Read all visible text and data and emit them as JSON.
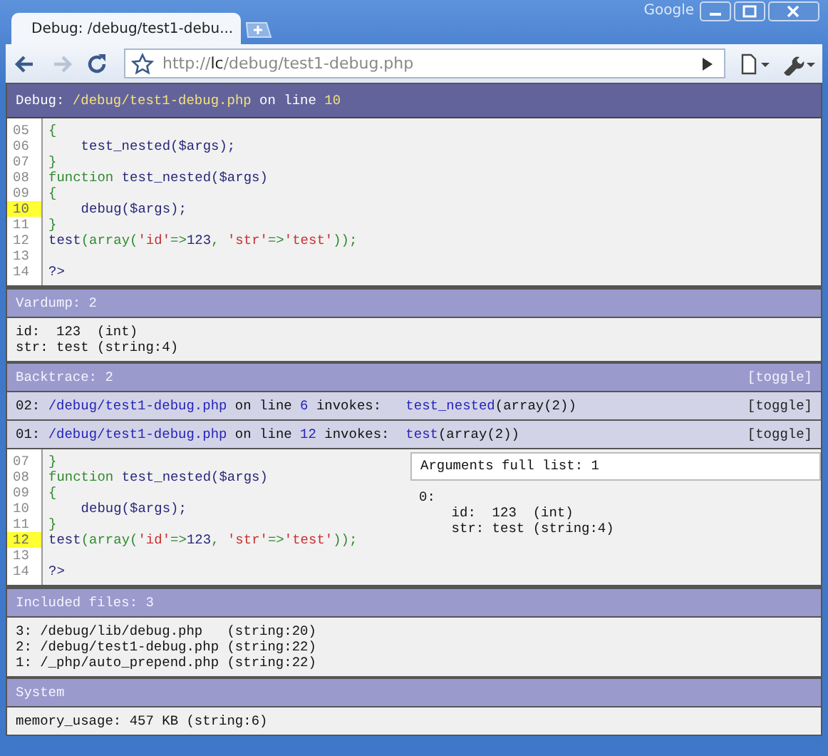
{
  "browser": {
    "tab_title": "Debug: /debug/test1-debu...",
    "brand": "Google",
    "address": "http://**lc**/debug/test1-debug.php",
    "forward_disabled": true
  },
  "debug_header": [
    {
      "text": "Debug: ",
      "kind": "plain"
    },
    {
      "text": "/debug/test1-debug.php",
      "kind": "accent"
    },
    {
      "text": " on line ",
      "kind": "plain"
    },
    {
      "text": "10",
      "kind": "accent"
    }
  ],
  "source": [
    {
      "number": "05",
      "highlighted": false,
      "tokens": [
        {
          "text": "{",
          "kind": "keyword"
        }
      ]
    },
    {
      "number": "06",
      "highlighted": false,
      "tokens": [
        {
          "text": "    test_nested($args);",
          "kind": "name"
        }
      ]
    },
    {
      "number": "07",
      "highlighted": false,
      "tokens": [
        {
          "text": "}",
          "kind": "keyword"
        }
      ]
    },
    {
      "number": "08",
      "highlighted": false,
      "tokens": [
        {
          "text": "function ",
          "kind": "keyword"
        },
        {
          "text": "test_nested($args)",
          "kind": "name"
        }
      ]
    },
    {
      "number": "09",
      "highlighted": false,
      "tokens": [
        {
          "text": "{",
          "kind": "keyword"
        }
      ]
    },
    {
      "number": "10",
      "highlighted": true,
      "tokens": [
        {
          "text": "    debug($args);",
          "kind": "name"
        }
      ]
    },
    {
      "number": "11",
      "highlighted": false,
      "tokens": [
        {
          "text": "}",
          "kind": "keyword"
        }
      ]
    },
    {
      "number": "12",
      "highlighted": false,
      "tokens": [
        {
          "text": "test",
          "kind": "name"
        },
        {
          "text": "(array(",
          "kind": "keyword"
        },
        {
          "text": "'id'",
          "kind": "string"
        },
        {
          "text": "=>",
          "kind": "keyword"
        },
        {
          "text": "123",
          "kind": "name"
        },
        {
          "text": ", ",
          "kind": "keyword"
        },
        {
          "text": "'str'",
          "kind": "string"
        },
        {
          "text": "=>",
          "kind": "keyword"
        },
        {
          "text": "'test'",
          "kind": "string"
        },
        {
          "text": "));",
          "kind": "keyword"
        }
      ]
    },
    {
      "number": "13",
      "highlighted": false
    },
    {
      "number": "14",
      "highlighted": false,
      "tokens": [
        {
          "text": "?>",
          "kind": "name"
        }
      ]
    }
  ],
  "sections": [
    {
      "kind": "text",
      "title": "Vardump: 2",
      "lines": [
        "id:  123  (int)",
        "str: test (string:4)"
      ]
    },
    {
      "kind": "backtrace",
      "title": "Backtrace: 2",
      "toggle": "[toggle]",
      "frames": [
        {
          "tokens": [
            {
              "text": "02: ",
              "kind": "plain"
            },
            {
              "text": "/debug/test1-debug.php",
              "kind": "link"
            },
            {
              "text": " on line ",
              "kind": "plain"
            },
            {
              "text": "6",
              "kind": "link"
            },
            {
              "text": " invokes:   ",
              "kind": "plain"
            },
            {
              "text": "test_nested",
              "kind": "link"
            },
            {
              "text": "(array(2))",
              "kind": "plain"
            }
          ],
          "toggle": "[toggle]"
        },
        {
          "tokens": [
            {
              "text": "01: ",
              "kind": "plain"
            },
            {
              "text": "/debug/test1-debug.php",
              "kind": "link"
            },
            {
              "text": " on line ",
              "kind": "plain"
            },
            {
              "text": "12",
              "kind": "link"
            },
            {
              "text": " invokes:  ",
              "kind": "plain"
            },
            {
              "text": "test",
              "kind": "link"
            },
            {
              "text": "(array(2))",
              "kind": "plain"
            }
          ],
          "toggle": "[toggle]",
          "source": [
            {
              "number": "07",
              "highlighted": false,
              "tokens": [
                {
                  "text": "}",
                  "kind": "keyword"
                }
              ]
            },
            {
              "number": "08",
              "highlighted": false,
              "tokens": [
                {
                  "text": "function ",
                  "kind": "keyword"
                },
                {
                  "text": "test_nested($args)",
                  "kind": "name"
                }
              ]
            },
            {
              "number": "09",
              "highlighted": false,
              "tokens": [
                {
                  "text": "{",
                  "kind": "keyword"
                }
              ]
            },
            {
              "number": "10",
              "highlighted": false,
              "tokens": [
                {
                  "text": "    debug($args);",
                  "kind": "name"
                }
              ]
            },
            {
              "number": "11",
              "highlighted": false,
              "tokens": [
                {
                  "text": "}",
                  "kind": "keyword"
                }
              ]
            },
            {
              "number": "12",
              "highlighted": true,
              "tokens": [
                {
                  "text": "test",
                  "kind": "name"
                },
                {
                  "text": "(array(",
                  "kind": "keyword"
                },
                {
                  "text": "'id'",
                  "kind": "string"
                },
                {
                  "text": "=>",
                  "kind": "keyword"
                },
                {
                  "text": "123",
                  "kind": "name"
                },
                {
                  "text": ", ",
                  "kind": "keyword"
                },
                {
                  "text": "'str'",
                  "kind": "string"
                },
                {
                  "text": "=>",
                  "kind": "keyword"
                },
                {
                  "text": "'test'",
                  "kind": "string"
                },
                {
                  "text": "));",
                  "kind": "keyword"
                }
              ]
            },
            {
              "number": "13",
              "highlighted": false
            },
            {
              "number": "14",
              "highlighted": false,
              "tokens": [
                {
                  "text": "?>",
                  "kind": "name"
                }
              ]
            }
          ],
          "arguments": {
            "title": "Arguments full list: 1",
            "lines": [
              "0:",
              "    id:  123  (int)",
              "    str: test (string:4)"
            ]
          }
        }
      ]
    },
    {
      "kind": "text",
      "title": "Included files: 3",
      "lines": [
        "3: /debug/lib/debug.php   (string:20)",
        "2: /debug/test1-debug.php (string:22)",
        "1: /_php/auto_prepend.php (string:22)"
      ]
    },
    {
      "kind": "text",
      "title": "System",
      "lines": [
        "memory_usage: 457 KB (string:6)"
      ]
    }
  ]
}
